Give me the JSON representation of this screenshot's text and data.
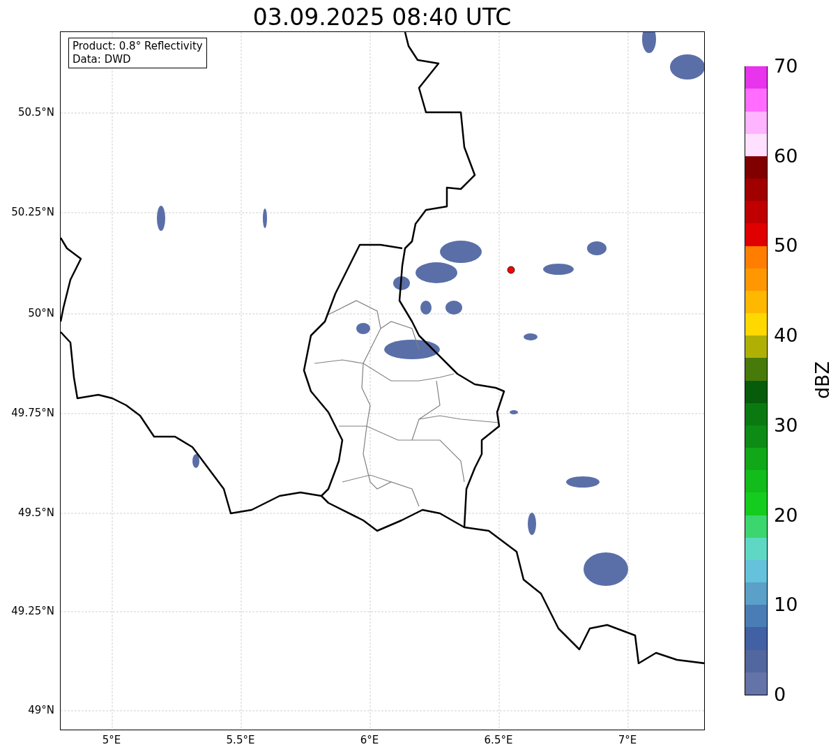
{
  "title": "03.09.2025 08:40 UTC",
  "info_box": {
    "lines": [
      "Product: 0.8° Reflectivity",
      "Data: DWD"
    ]
  },
  "map": {
    "x_ticks": [
      "5°E",
      "5.5°E",
      "6°E",
      "6.5°E",
      "7°E"
    ],
    "y_ticks": [
      "50.5°N",
      "50.25°N",
      "50°N",
      "49.75°N",
      "49.5°N",
      "49.25°N",
      "49°N"
    ]
  },
  "colorbar": {
    "label": "dBZ",
    "ticks": [
      "70",
      "60",
      "50",
      "40",
      "30",
      "20",
      "10",
      "0"
    ],
    "segments": [
      {
        "color": "#6473a8"
      },
      {
        "color": "#52669f"
      },
      {
        "color": "#4260a4"
      },
      {
        "color": "#4a7db5"
      },
      {
        "color": "#5aa0c8"
      },
      {
        "color": "#64c2dc"
      },
      {
        "color": "#5ed8c4"
      },
      {
        "color": "#3cd66e"
      },
      {
        "color": "#14cc1e"
      },
      {
        "color": "#12bc1a"
      },
      {
        "color": "#10a818"
      },
      {
        "color": "#0c8c14"
      },
      {
        "color": "#0a7a10"
      },
      {
        "color": "#065c0a"
      },
      {
        "color": "#487a0a"
      },
      {
        "color": "#b0b004"
      },
      {
        "color": "#ffd800"
      },
      {
        "color": "#ffb800"
      },
      {
        "color": "#ff9800"
      },
      {
        "color": "#ff7e00"
      },
      {
        "color": "#e00000"
      },
      {
        "color": "#c00000"
      },
      {
        "color": "#a00000"
      },
      {
        "color": "#800000"
      },
      {
        "color": "#ffe0ff"
      },
      {
        "color": "#ffb4ff"
      },
      {
        "color": "#ff6cff"
      },
      {
        "color": "#e834ec"
      }
    ]
  }
}
